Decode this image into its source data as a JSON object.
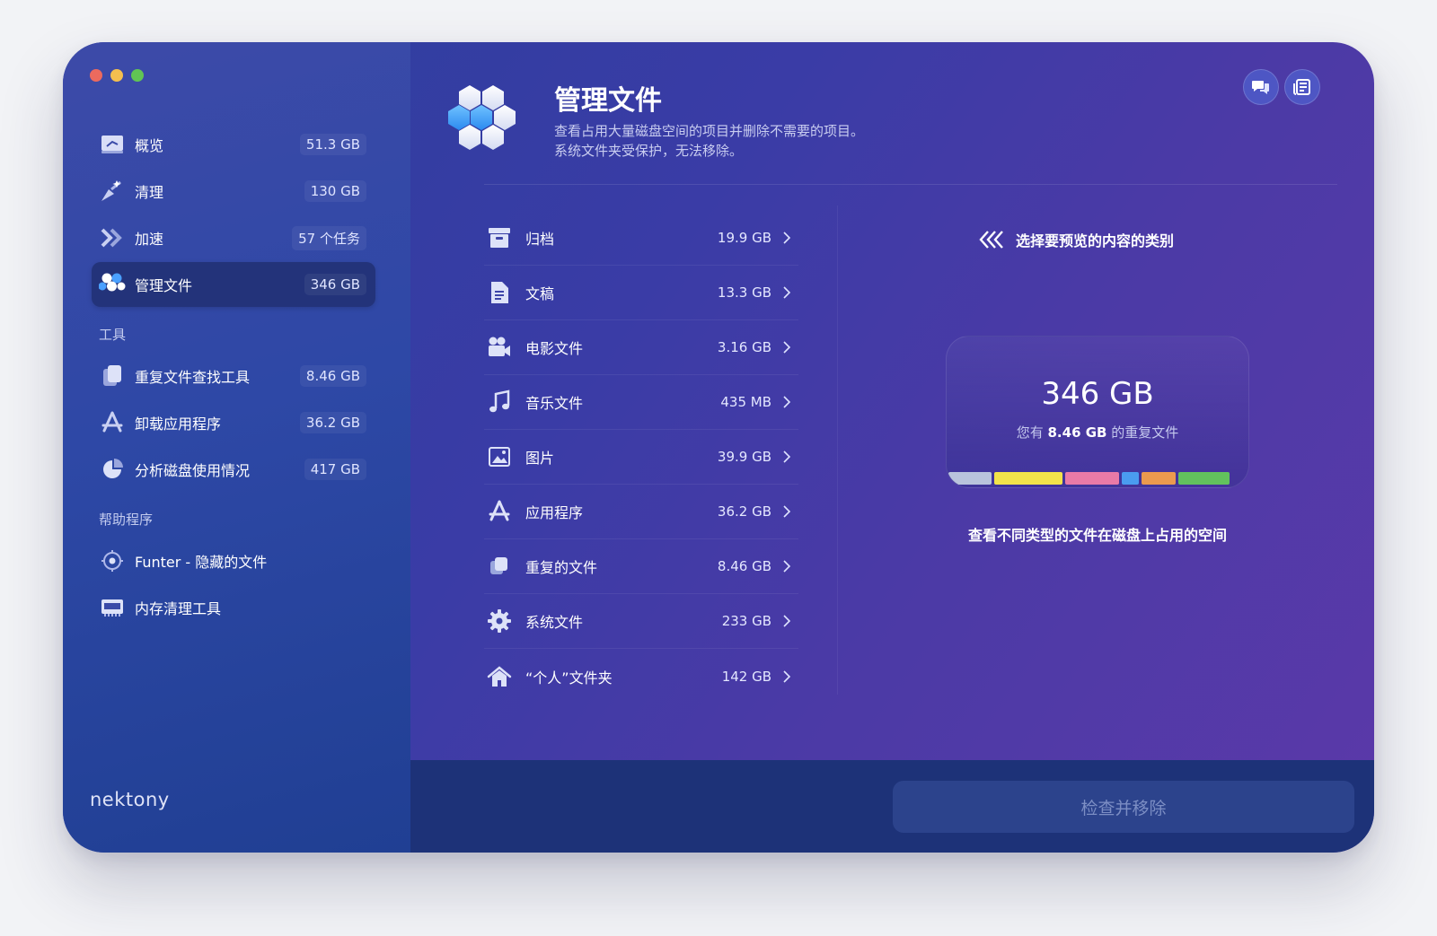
{
  "window": {
    "controls": [
      "close",
      "minimize",
      "zoom"
    ]
  },
  "sidebar": {
    "items": [
      {
        "label": "概览",
        "value": "51.3 GB",
        "icon": "dashboard-icon"
      },
      {
        "label": "清理",
        "value": "130 GB",
        "icon": "broom-icon"
      },
      {
        "label": "加速",
        "value": "57 个任务",
        "icon": "speedup-chevrons-icon"
      },
      {
        "label": "管理文件",
        "value": "346 GB",
        "icon": "hexagons-icon",
        "active": true
      }
    ],
    "tools_heading": "工具",
    "tools": [
      {
        "label": "重复文件查找工具",
        "value": "8.46 GB",
        "icon": "duplicate-files-icon"
      },
      {
        "label": "卸载应用程序",
        "value": "36.2 GB",
        "icon": "app-store-icon"
      },
      {
        "label": "分析磁盘使用情况",
        "value": "417 GB",
        "icon": "pie-chart-icon"
      }
    ],
    "helpers_heading": "帮助程序",
    "helpers": [
      {
        "label": "Funter - 隐藏的文件",
        "icon": "funter-eye-icon"
      },
      {
        "label": "内存清理工具",
        "icon": "memory-chip-icon"
      }
    ],
    "brand": "nektony"
  },
  "header": {
    "title": "管理文件",
    "description_line1": "查看占用大量磁盘空间的项目并删除不需要的项目。",
    "description_line2": "系统文件夹受保护，无法移除。",
    "buttons": [
      "chat-icon",
      "news-icon"
    ]
  },
  "categories": [
    {
      "label": "归档",
      "value": "19.9 GB",
      "icon": "archive-box-icon"
    },
    {
      "label": "文稿",
      "value": "13.3 GB",
      "icon": "document-icon"
    },
    {
      "label": "电影文件",
      "value": "3.16 GB",
      "icon": "movie-camera-icon"
    },
    {
      "label": "音乐文件",
      "value": "435 MB",
      "icon": "music-note-icon"
    },
    {
      "label": "图片",
      "value": "39.9 GB",
      "icon": "picture-icon"
    },
    {
      "label": "应用程序",
      "value": "36.2 GB",
      "icon": "app-store-icon"
    },
    {
      "label": "重复的文件",
      "value": "8.46 GB",
      "icon": "duplicate-files-icon"
    },
    {
      "label": "系统文件",
      "value": "233 GB",
      "icon": "gear-icon"
    },
    {
      "label": "“个人”文件夹",
      "value": "142 GB",
      "icon": "home-icon"
    }
  ],
  "preview": {
    "hint": "选择要预览的内容的类别",
    "total": "346 GB",
    "dup_prefix": "您有",
    "dup_size": "8.46 GB",
    "dup_suffix": "的重复文件",
    "caption": "查看不同类型的文件在磁盘上占用的空间",
    "bar_segments": [
      {
        "color": "#b9c3dc",
        "share": 0.15
      },
      {
        "color": "#f2e34a",
        "share": 0.24
      },
      {
        "color": "#e97aa7",
        "share": 0.19
      },
      {
        "color": "#4a9cf0",
        "share": 0.06
      },
      {
        "color": "#eb9a4e",
        "share": 0.12
      },
      {
        "color": "#62c25d",
        "share": 0.18
      }
    ]
  },
  "footer": {
    "action_label": "检查并移除"
  }
}
